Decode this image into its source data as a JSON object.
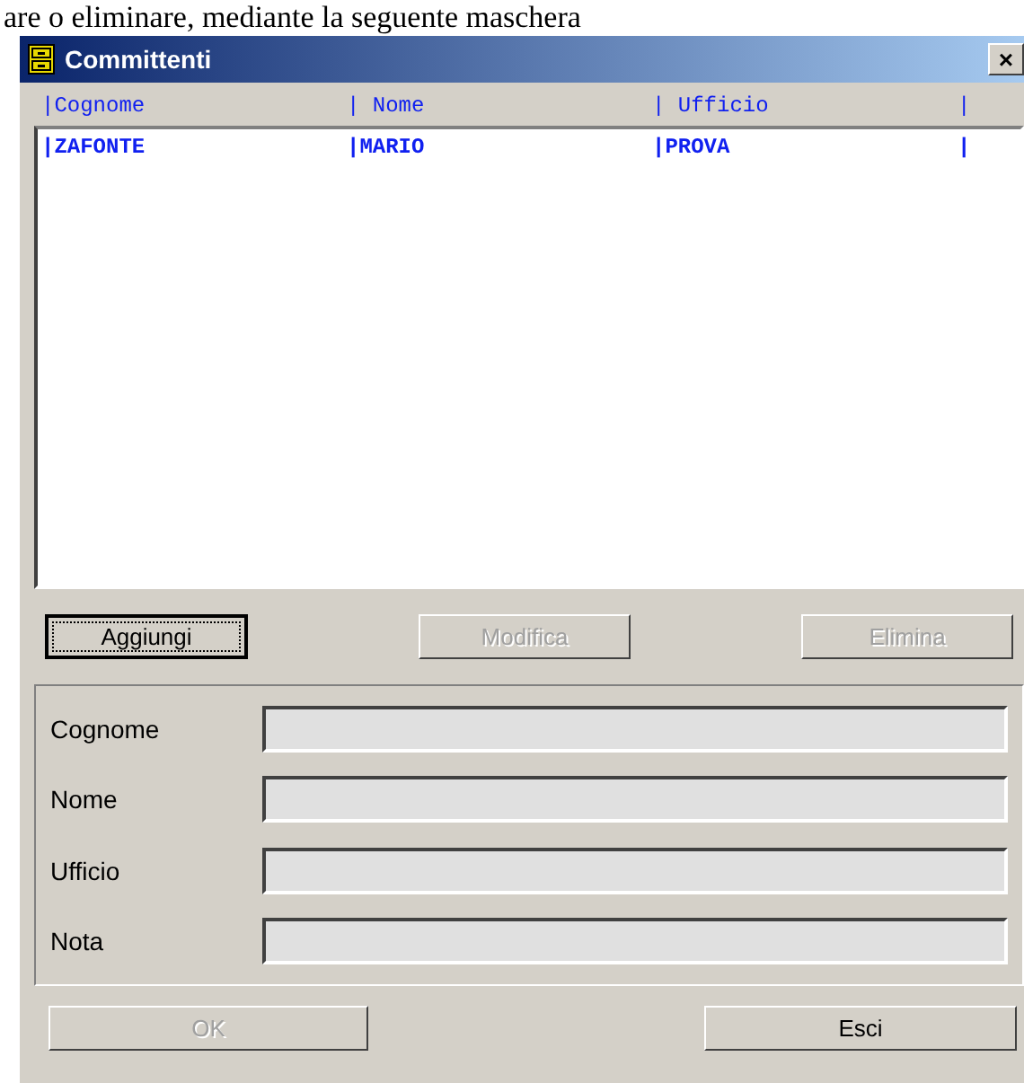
{
  "caption": "are o eliminare, mediante la seguente maschera",
  "window": {
    "title": "Committenti",
    "close": "×"
  },
  "list": {
    "columns": [
      "|Cognome",
      "| Nome",
      "| Ufficio",
      "|"
    ],
    "rows": [
      {
        "cells": [
          "|ZAFONTE",
          "|MARIO",
          "|PROVA",
          "|"
        ],
        "selected": false
      }
    ]
  },
  "actions": [
    {
      "label": "Aggiungi",
      "disabled": false,
      "focused": true
    },
    {
      "label": "Modifica",
      "disabled": true,
      "focused": false
    },
    {
      "label": "Elimina",
      "disabled": true,
      "focused": false
    }
  ],
  "fields": [
    {
      "label": "Cognome",
      "disabled": true
    },
    {
      "label": "Nome",
      "disabled": true
    },
    {
      "label": "Ufficio",
      "disabled": true
    },
    {
      "label": "Nota",
      "disabled": true
    }
  ],
  "footer": [
    {
      "label": "OK",
      "disabled": true
    },
    {
      "label": "Esci",
      "disabled": false
    }
  ]
}
